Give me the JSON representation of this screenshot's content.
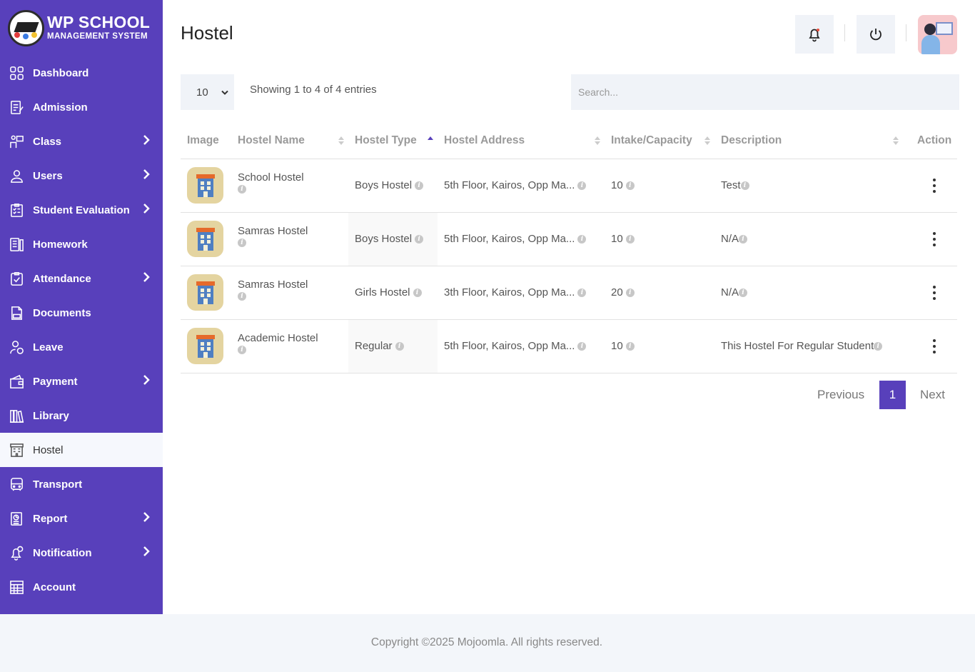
{
  "brand": {
    "title": "WP SCHOOL",
    "subtitle": "MANAGEMENT SYSTEM"
  },
  "sidebar": {
    "items": [
      {
        "label": "Dashboard",
        "icon": "dashboard-icon",
        "has_submenu": false
      },
      {
        "label": "Admission",
        "icon": "admission-icon",
        "has_submenu": false
      },
      {
        "label": "Class",
        "icon": "class-icon",
        "has_submenu": true
      },
      {
        "label": "Users",
        "icon": "user-icon",
        "has_submenu": true
      },
      {
        "label": "Student Evaluation",
        "icon": "evaluation-icon",
        "has_submenu": true
      },
      {
        "label": "Homework",
        "icon": "homework-icon",
        "has_submenu": false
      },
      {
        "label": "Attendance",
        "icon": "attendance-icon",
        "has_submenu": true
      },
      {
        "label": "Documents",
        "icon": "document-icon",
        "has_submenu": false
      },
      {
        "label": "Leave",
        "icon": "leave-icon",
        "has_submenu": false
      },
      {
        "label": "Payment",
        "icon": "payment-icon",
        "has_submenu": true
      },
      {
        "label": "Library",
        "icon": "library-icon",
        "has_submenu": false
      },
      {
        "label": "Hostel",
        "icon": "hostel-icon",
        "has_submenu": false,
        "active": true
      },
      {
        "label": "Transport",
        "icon": "bus-icon",
        "has_submenu": false
      },
      {
        "label": "Report",
        "icon": "report-icon",
        "has_submenu": true
      },
      {
        "label": "Notification",
        "icon": "notification-icon",
        "has_submenu": true
      },
      {
        "label": "Account",
        "icon": "account-icon",
        "has_submenu": false
      }
    ]
  },
  "header": {
    "title": "Hostel"
  },
  "table_controls": {
    "page_length": "10",
    "info": "Showing 1 to 4 of 4 entries",
    "search_placeholder": "Search..."
  },
  "table": {
    "columns": [
      "Image",
      "Hostel Name",
      "Hostel Type",
      "Hostel Address",
      "Intake/Capacity",
      "Description",
      "Action"
    ],
    "rows": [
      {
        "name": "School Hostel",
        "type": "Boys Hostel",
        "address": "5th Floor, Kairos, Opp Ma...",
        "capacity": "10",
        "description": "Test"
      },
      {
        "name": "Samras Hostel",
        "type": "Boys Hostel",
        "address": "5th Floor, Kairos, Opp Ma...",
        "capacity": "10",
        "description": "N/A"
      },
      {
        "name": "Samras Hostel",
        "type": "Girls Hostel",
        "address": "3th Floor, Kairos, Opp Ma...",
        "capacity": "20",
        "description": "N/A"
      },
      {
        "name": "Academic Hostel",
        "type": "Regular",
        "address": "5th Floor, Kairos, Opp Ma...",
        "capacity": "10",
        "description": "This Hostel For Regular Student"
      }
    ]
  },
  "pagination": {
    "previous": "Previous",
    "current": "1",
    "next": "Next"
  },
  "footer": {
    "copyright": "Copyright ©2025 Mojoomla. All rights reserved."
  },
  "colors": {
    "accent": "#5840bb",
    "panel": "#f0f3f8"
  }
}
